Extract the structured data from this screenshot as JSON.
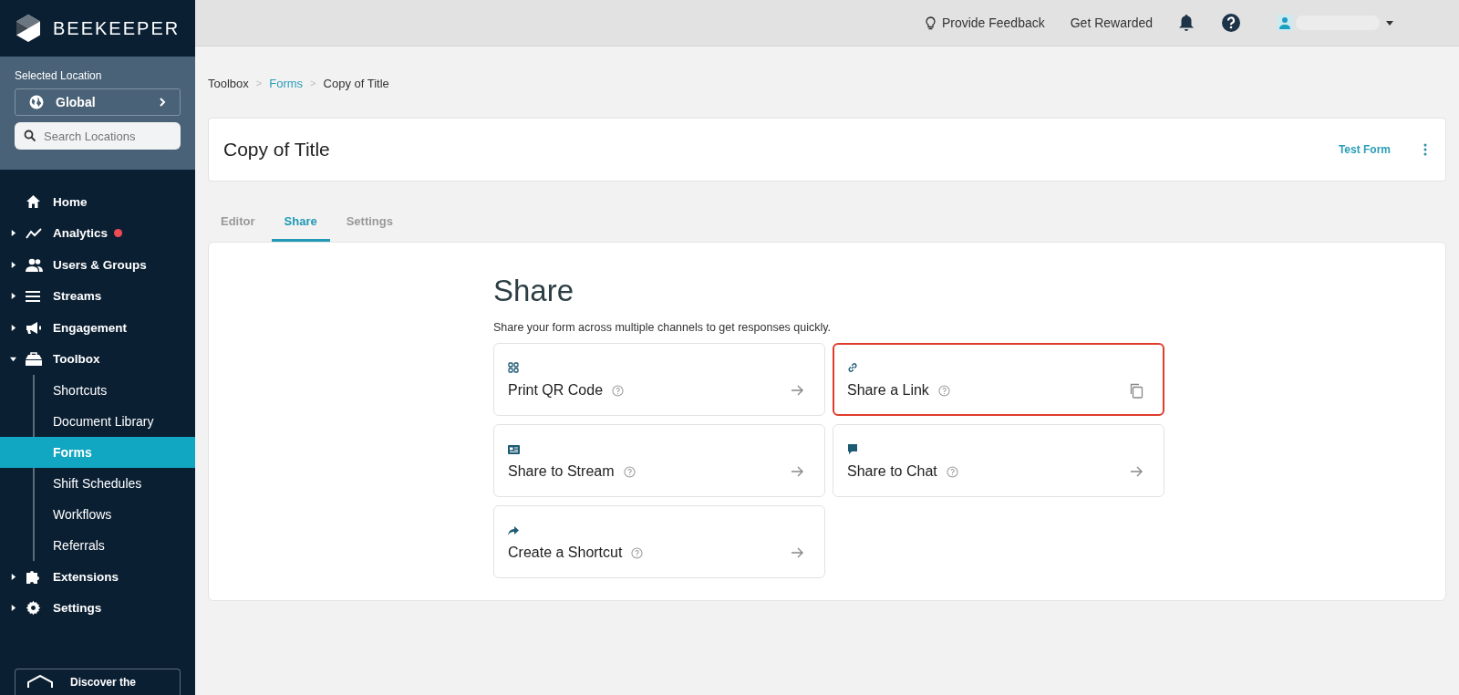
{
  "sidebar": {
    "brand": "BEEKEEPER",
    "location_label": "Selected Location",
    "location": "Global",
    "search": {
      "placeholder": "Search Locations"
    },
    "items": [
      {
        "label": "Home",
        "expandable": false,
        "selected": false,
        "badge": false
      },
      {
        "label": "Analytics",
        "expandable": true,
        "expanded": false,
        "selected": false,
        "badge": true
      },
      {
        "label": "Users & Groups",
        "expandable": true,
        "expanded": false,
        "selected": false,
        "badge": false
      },
      {
        "label": "Streams",
        "expandable": true,
        "expanded": false,
        "selected": false,
        "badge": false
      },
      {
        "label": "Engagement",
        "expandable": true,
        "expanded": false,
        "selected": false,
        "badge": false
      },
      {
        "label": "Toolbox",
        "expandable": true,
        "expanded": true,
        "selected": false,
        "badge": false,
        "children": [
          {
            "label": "Shortcuts",
            "selected": false
          },
          {
            "label": "Document Library",
            "selected": false
          },
          {
            "label": "Forms",
            "selected": true
          },
          {
            "label": "Shift Schedules",
            "selected": false
          },
          {
            "label": "Workflows",
            "selected": false
          },
          {
            "label": "Referrals",
            "selected": false
          }
        ]
      },
      {
        "label": "Extensions",
        "expandable": true,
        "expanded": false,
        "selected": false,
        "badge": false
      },
      {
        "label": "Settings",
        "expandable": true,
        "expanded": false,
        "selected": false,
        "badge": false
      }
    ],
    "promo": "Discover the"
  },
  "top_bar": {
    "feedback": "Provide Feedback",
    "rewards": "Get Rewarded"
  },
  "breadcrumb": [
    {
      "label": "Toolbox",
      "link": false
    },
    {
      "label": "Forms",
      "link": true
    },
    {
      "label": "Copy of Title",
      "link": false
    }
  ],
  "breadcrumb_separator": ">",
  "form": {
    "title": "Copy of Title",
    "test_button": "Test Form"
  },
  "tabs": [
    {
      "label": "Editor",
      "selected": false
    },
    {
      "label": "Share",
      "selected": true
    },
    {
      "label": "Settings",
      "selected": false
    }
  ],
  "share": {
    "heading": "Share",
    "description": "Share your form across multiple channels to get responses quickly.",
    "options": [
      {
        "label": "Print QR Code",
        "kind": "qr",
        "copyable": false,
        "highlighted": false
      },
      {
        "label": "Share a Link",
        "kind": "link",
        "copyable": true,
        "highlighted": true
      },
      {
        "label": "Share to Stream",
        "kind": "stream",
        "copyable": false,
        "highlighted": false
      },
      {
        "label": "Share to Chat",
        "kind": "chat",
        "copyable": false,
        "highlighted": false
      },
      {
        "label": "Create a Shortcut",
        "kind": "shortcut",
        "copyable": false,
        "highlighted": false
      }
    ]
  }
}
